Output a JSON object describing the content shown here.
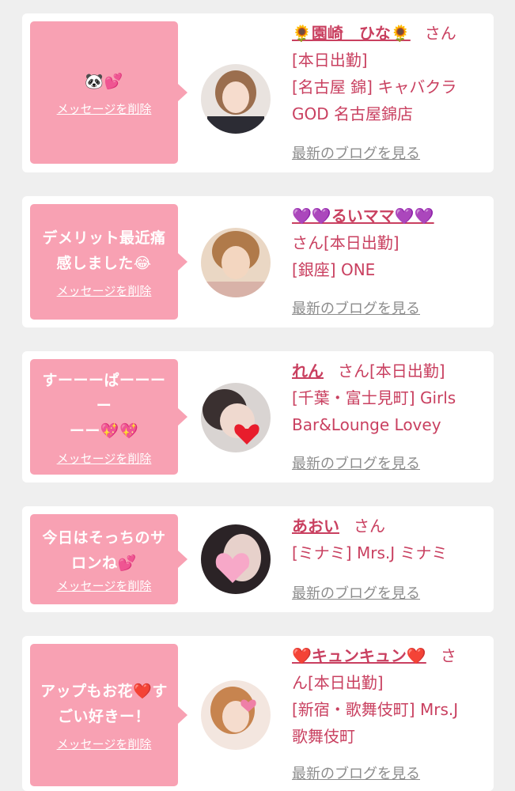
{
  "delete_label": "メッセージを削除",
  "blog_label": "最新のブログを見る",
  "colors": {
    "background": "#efefef",
    "card": "#ffffff",
    "bubble": "#f8a1b3",
    "name_text": "#c94060",
    "link_gray": "#8c8c8c"
  },
  "items": [
    {
      "message": [
        "🐼💕"
      ],
      "name": "🌻園崎　ひな🌻",
      "suffix": "さん",
      "info_lines": [
        "[本日出勤]",
        "[名古屋 錦] キャバクラ",
        "GOD 名古屋錦店"
      ]
    },
    {
      "message": [
        "デメリット最近痛",
        "感しました😂"
      ],
      "name": "💜💜るいママ💜💜",
      "suffix": "",
      "info_lines": [
        "さん[本日出勤]",
        "[銀座] ONE"
      ]
    },
    {
      "message": [
        "すーーーぱーーーー",
        "ーー💖💖"
      ],
      "name": "れん",
      "suffix": "さん[本日出勤]",
      "info_lines": [
        "[千葉・富士見町] Girls",
        "Bar&Lounge Lovey"
      ]
    },
    {
      "message": [
        "今日はそっちのサ",
        "ロンね💕"
      ],
      "name": "あおい",
      "suffix": "さん",
      "info_lines": [
        "[ミナミ] Mrs.J ミナミ"
      ]
    },
    {
      "message": [
        "アップもお花❤️す",
        "ごい好きー！"
      ],
      "name": "❤️キュンキュン❤️",
      "suffix": "さ",
      "info_lines": [
        "ん[本日出勤]",
        "[新宿・歌舞伎町] Mrs.J",
        "歌舞伎町"
      ]
    }
  ]
}
